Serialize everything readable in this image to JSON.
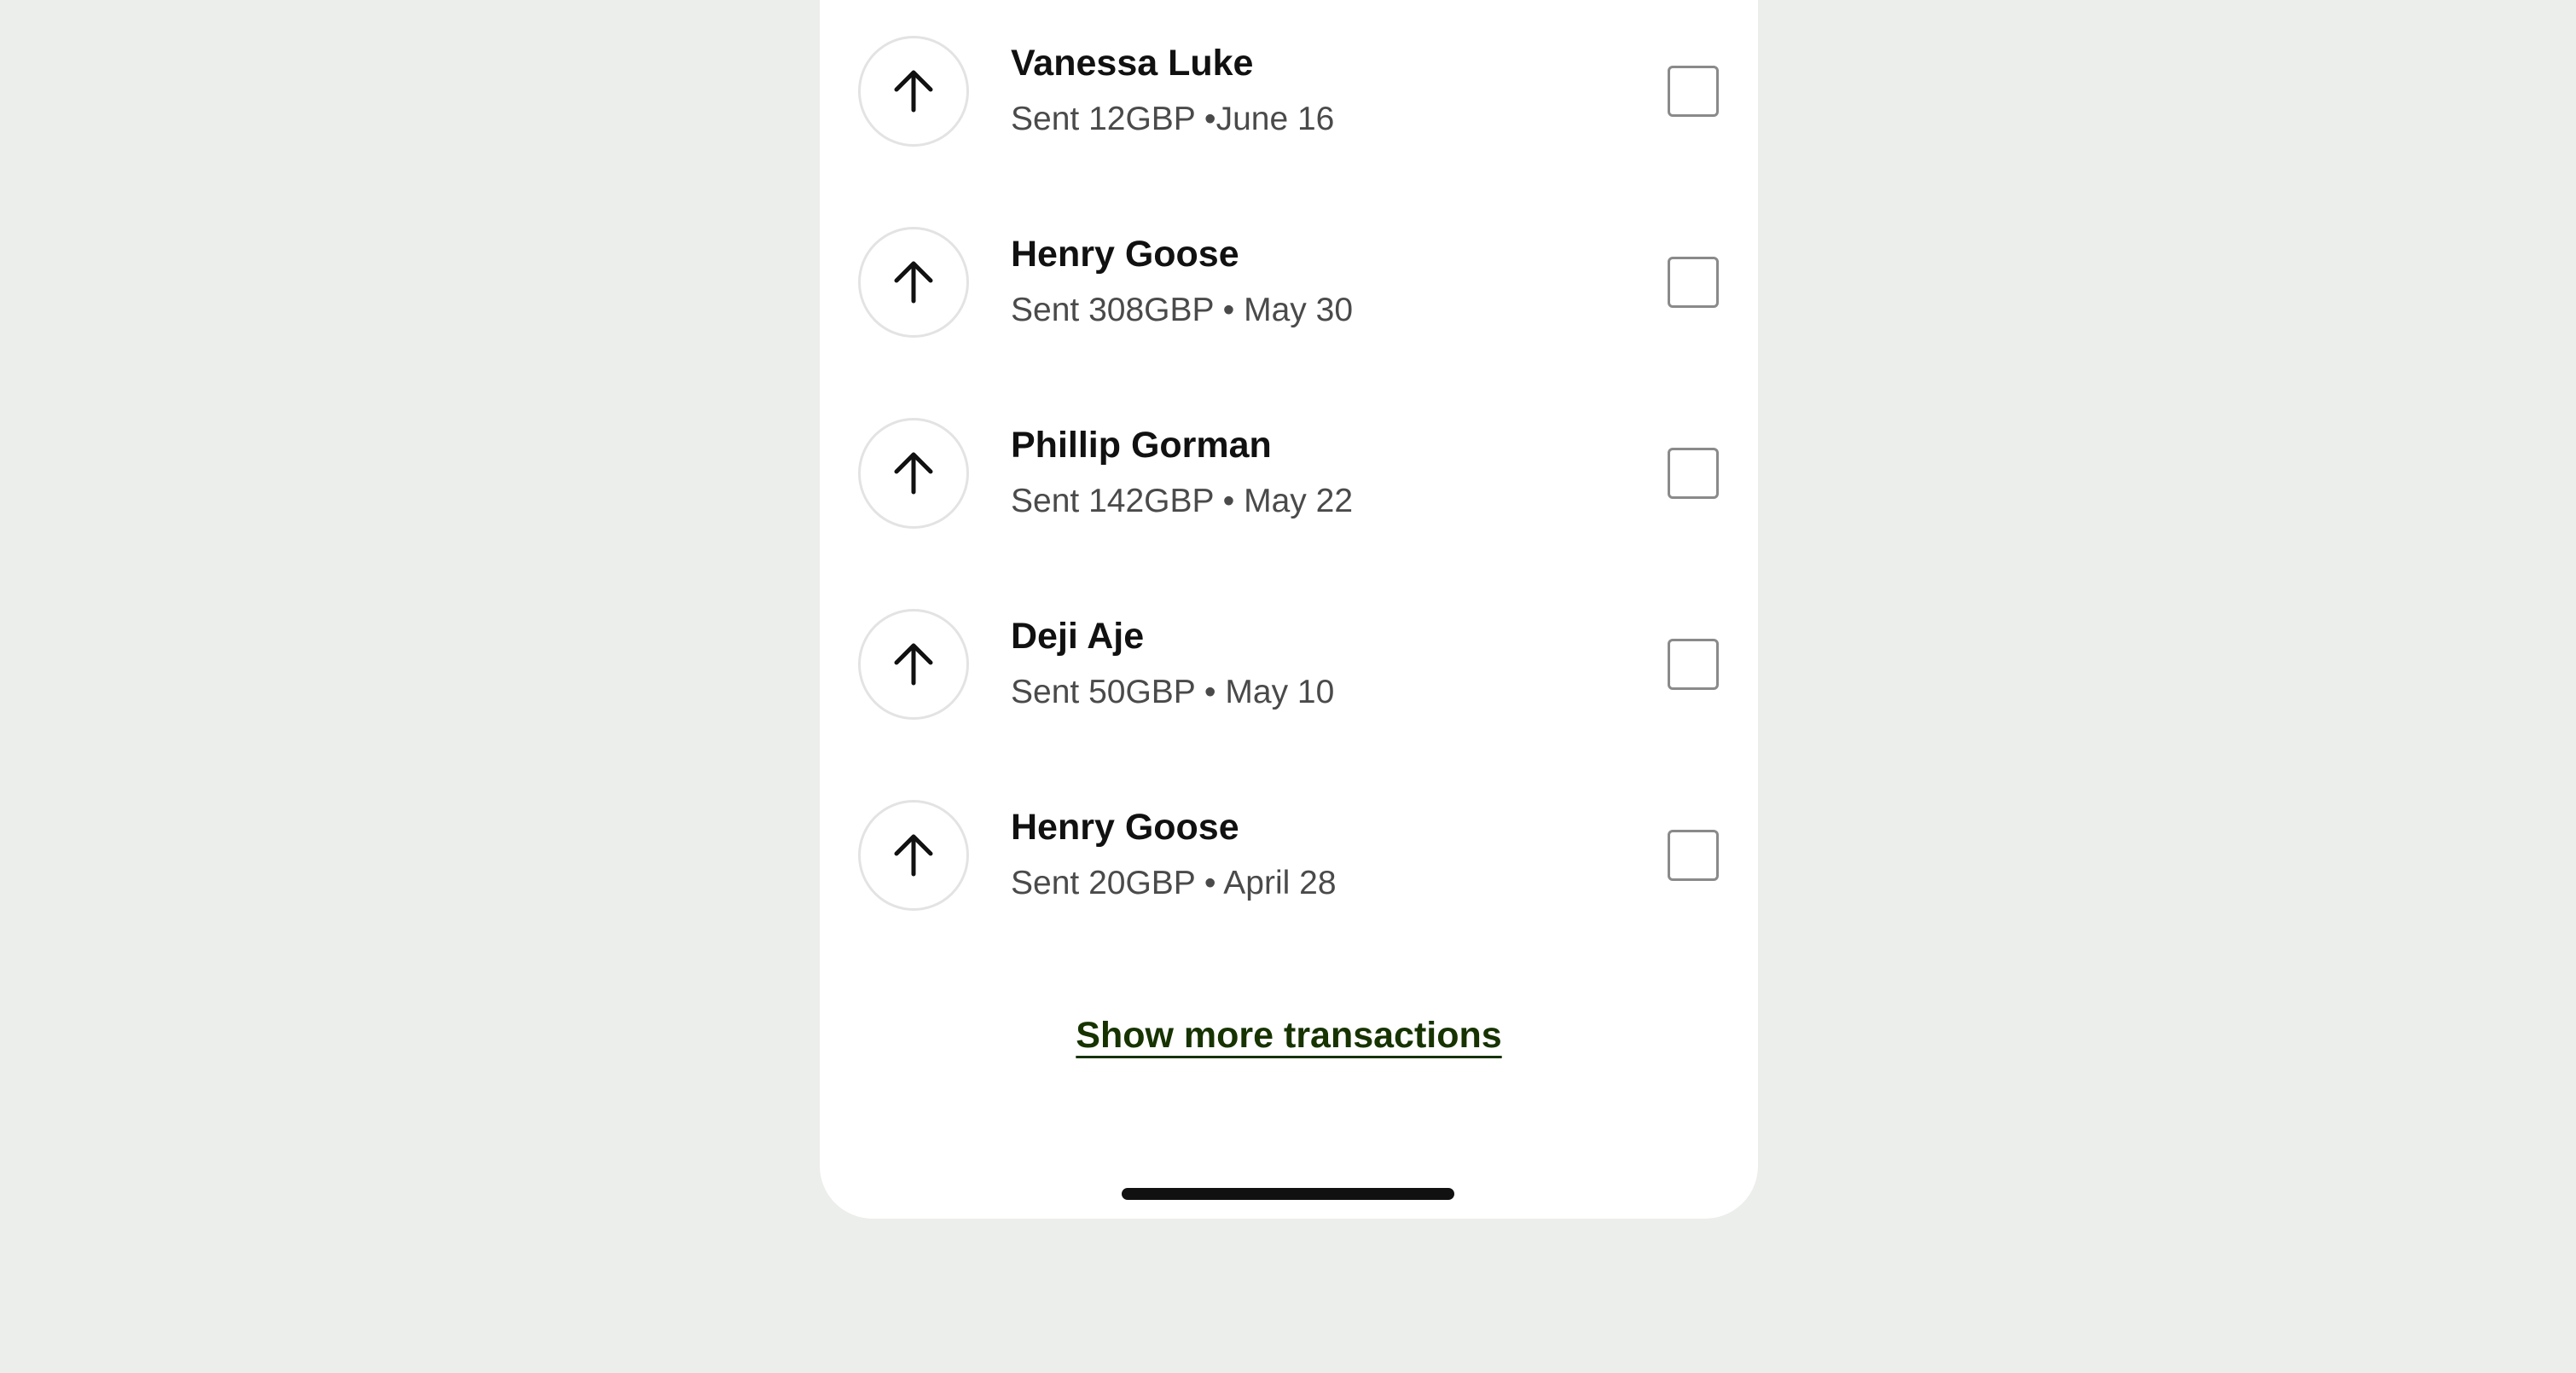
{
  "transactions": [
    {
      "name": "Vanessa Luke",
      "detail": "Sent 12GBP •June 16",
      "icon": "arrow-up-icon"
    },
    {
      "name": "Henry Goose",
      "detail": "Sent 308GBP • May 30",
      "icon": "arrow-up-icon"
    },
    {
      "name": "Phillip Gorman",
      "detail": "Sent 142GBP • May 22",
      "icon": "arrow-up-icon"
    },
    {
      "name": "Deji Aje",
      "detail": "Sent 50GBP • May 10",
      "icon": "arrow-up-icon"
    },
    {
      "name": "Henry Goose",
      "detail": "Sent 20GBP • April 28",
      "icon": "arrow-up-icon"
    }
  ],
  "show_more_label": "Show more transactions",
  "colors": {
    "background": "#eceeeb",
    "card": "#ffffff",
    "link": "#163300",
    "text_primary": "#111111",
    "text_secondary": "#4a4a4a"
  }
}
